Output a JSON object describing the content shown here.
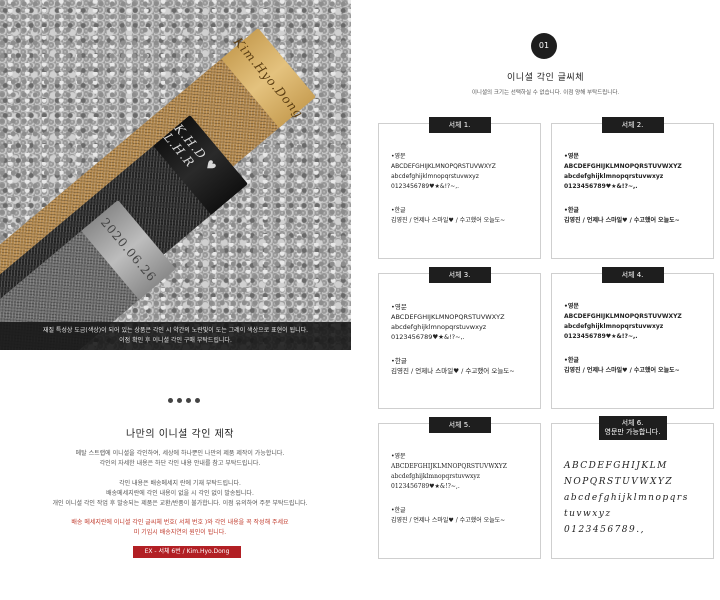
{
  "photo": {
    "engravings": [
      "Kim.Hyo.Dong",
      "K.H.D ♥ L.H.R",
      "2020.06.26"
    ],
    "caption_lines": [
      "재질 특성상 도금(색상)이 되어 있는 상품은 각인 시 약간의 노란빛이 도는 그레이 색상으로 표현이 됩니다.",
      "이점 확인 후 이니셜 각인 구매 부탁드립니다."
    ]
  },
  "left": {
    "title": "나만의 이니셜 각인 제작",
    "para1": [
      "메탈 스트랩에 이니셜을 각인하여, 세상에 하나뿐인 나만의 제품 제작이 가능합니다.",
      "각인의 자세한 내용은 하단 각인 내용 안내를 참고 부탁드립니다."
    ],
    "para2": [
      "각인 내용은 배송메세지 란에 기재 부탁드립니다.",
      "배송메세지란에 각인 내용이 없을 시 각인 없이 발송됩니다.",
      "개인 이니셜 각인 작업 후 발송되는 제품은 교환/반품이 불가합니다. 이점 유의하여 주문 부탁드립니다."
    ],
    "red_note": [
      "배송 메세지란에 이니셜 각인 글씨체 번호( 서체 번호 )와 각인 내용을 꼭 작성해 주세요",
      "미 기입시 배송지연의 원인이 됩니다."
    ],
    "example_badge": "EX - 서체 6번 / Kim.Hyo.Dong"
  },
  "right": {
    "step_number": "01",
    "title": "이니셜 각인 글씨체",
    "subtitle": "이니셜의 크기는 선택하실 수 없습니다. 이점 양해 부탁드립니다.",
    "fonts": [
      {
        "label": "서체 1.",
        "en_heading": "•영문",
        "upper": "ABCDEFGHIJKLMNOPQRSTUVWXYZ",
        "lower": "abcdefghijklmnopqrstuvwxyz",
        "digits": "0123456789♥★&!?~,.",
        "ko_heading": "•한글",
        "ko_sample": "김영진 / 언제나 스마일♥ / 수고했어 오늘도~"
      },
      {
        "label": "서체 2.",
        "en_heading": "•영문",
        "upper": "ABCDEFGHIJKLMNOPQRSTUVWXYZ",
        "lower": "abcdefghijklmnopqrstuvwxyz",
        "digits": "0123456789♥★&!?~,.",
        "ko_heading": "•한글",
        "ko_sample": "김영진 / 언제나 스마일♥ / 수고했어 오늘도~"
      },
      {
        "label": "서체 3.",
        "en_heading": "•영문",
        "upper": "ABCDEFGHIJKLMNOPQRSTUVWXYZ",
        "lower": "abcdefghijklmnopqrstuvwxyz",
        "digits": "0123456789♥★&!?~,.",
        "ko_heading": "•한글",
        "ko_sample": "김영진 / 언제나 스마일♥ / 수고했어 오늘도~"
      },
      {
        "label": "서체 4.",
        "en_heading": "•영문",
        "upper": "ABCDEFGHIJKLMNOPQRSTUVWXYZ",
        "lower": "abcdefghijklmnopqrstuvwxyz",
        "digits": "0123456789♥★&!?~,.",
        "ko_heading": "•한글",
        "ko_sample": "김영진 / 언제나 스마일♥ / 수고했어 오늘도~"
      },
      {
        "label": "서체 5.",
        "en_heading": "•영문",
        "upper": "ABCDEFGHIJKLMNOPQRSTUVWXYZ",
        "lower": "abcdefghijklmnopqrstuvwxyz",
        "digits": "0123456789♥★&!?~,.",
        "ko_heading": "•한글",
        "ko_sample": "김영진 / 언제나 스마일♥ / 수고했어 오늘도~"
      },
      {
        "label": "서체 6.",
        "label_sub": "영문만 가능합니다.",
        "script_upper1": "ABCDEFGHIJKLM",
        "script_upper2": "NOPQRSTUVWXYZ",
        "script_lower1": "abcdefghijklmnopqrs",
        "script_lower2": "tuvwxyz",
        "script_digits": "0123456789.,"
      }
    ]
  }
}
